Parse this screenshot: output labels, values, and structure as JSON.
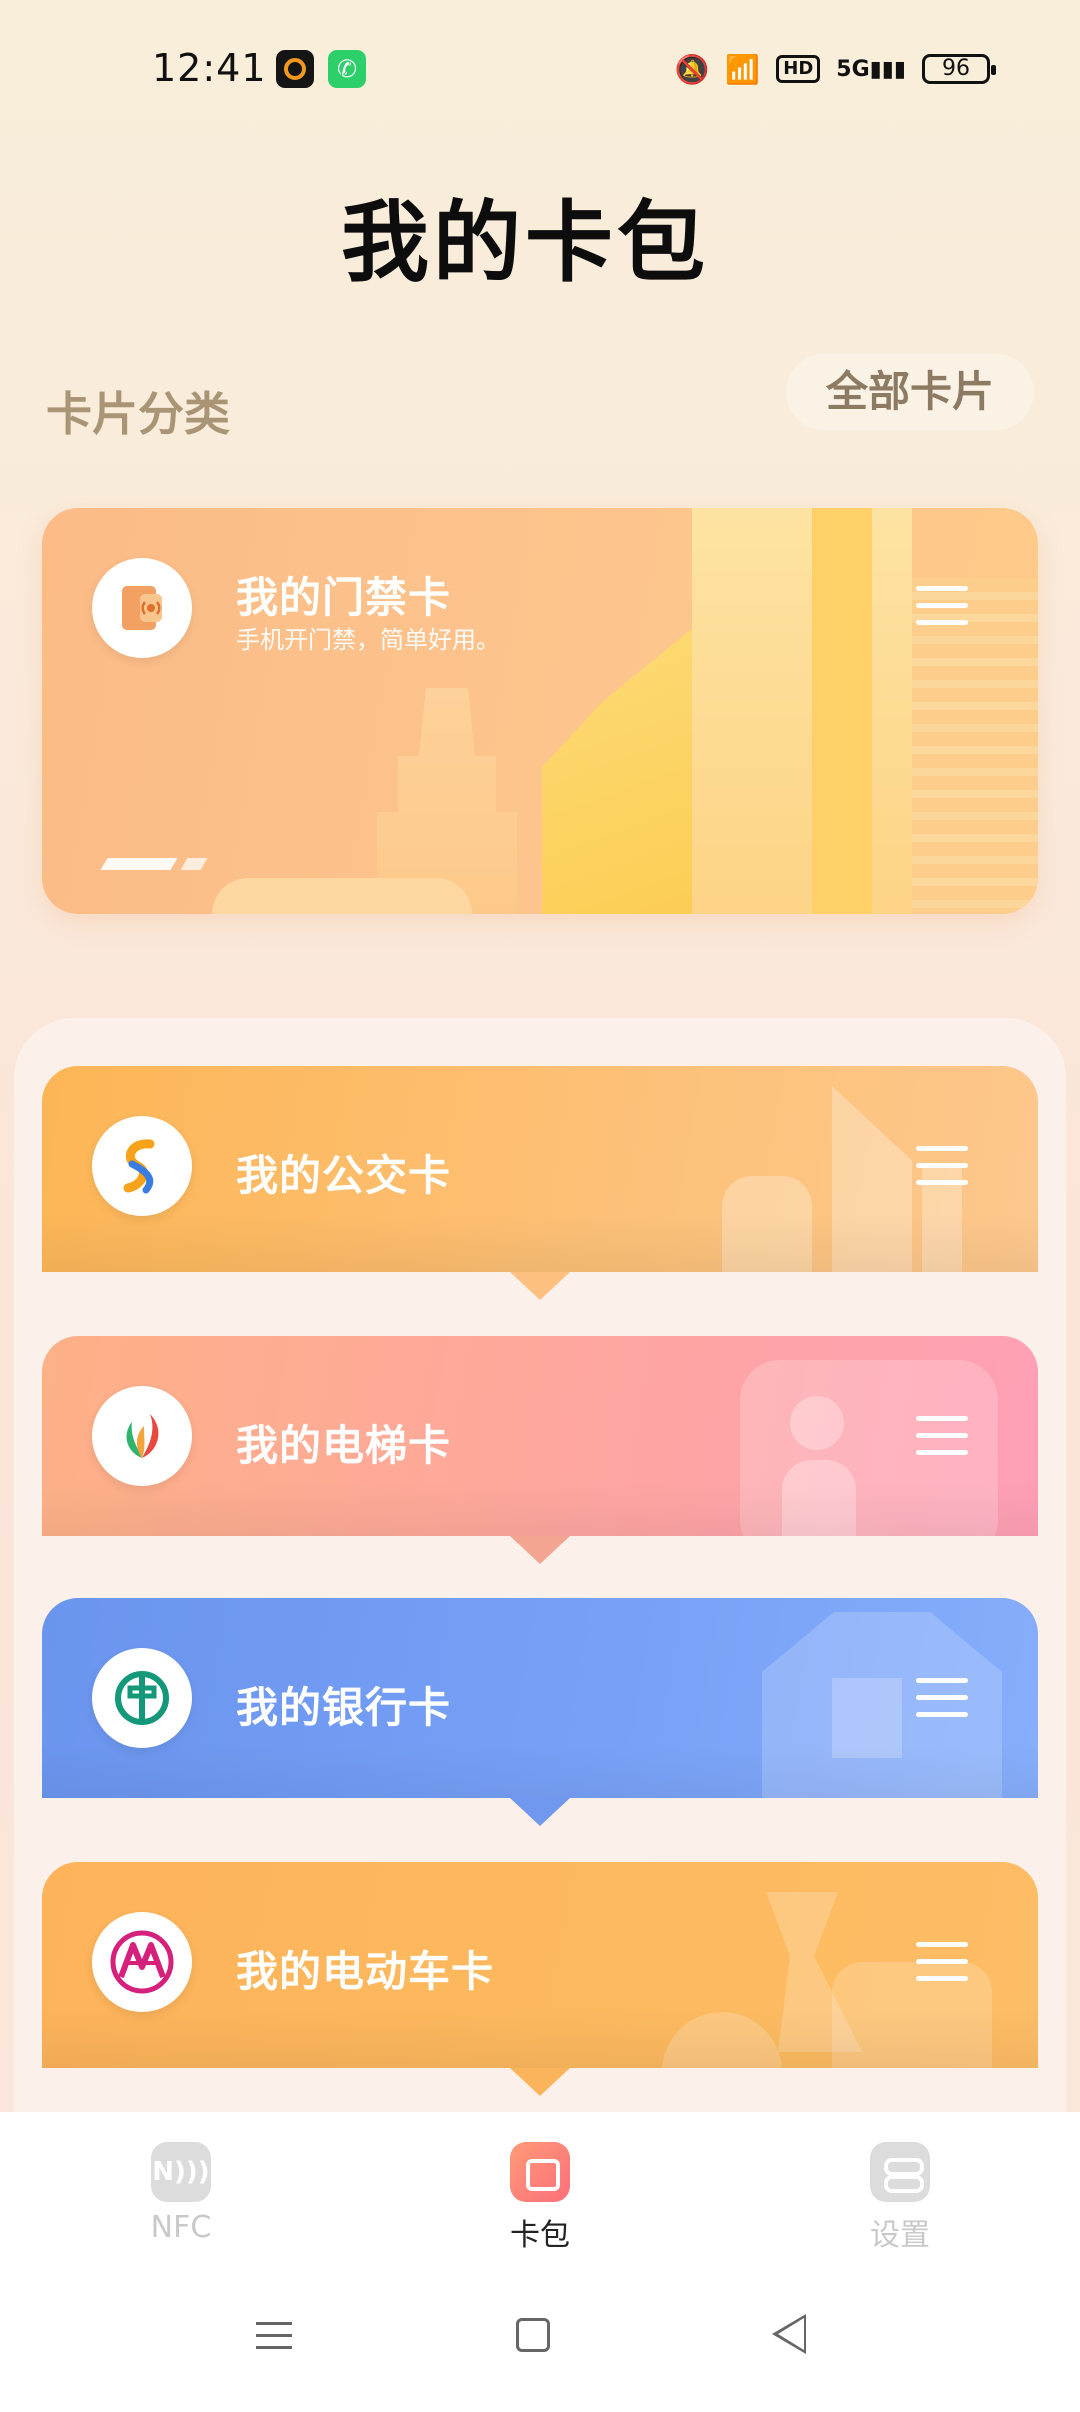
{
  "status_bar": {
    "time": "12:41",
    "battery": "96",
    "hd": "HD",
    "signal": "5G"
  },
  "title": "我的卡包",
  "categories": {
    "label": "卡片分类",
    "all_button": "全部卡片"
  },
  "door_card": {
    "title": "我的门禁卡",
    "subtitle": "手机开门禁，简单好用。"
  },
  "cards": [
    {
      "title": "我的公交卡",
      "icon": "bus-card-logo-icon"
    },
    {
      "title": "我的电梯卡",
      "icon": "elevator-card-logo-icon"
    },
    {
      "title": "我的银行卡",
      "icon": "bank-card-logo-icon"
    },
    {
      "title": "我的电动车卡",
      "icon": "ebike-card-logo-icon"
    }
  ],
  "bottom_nav": {
    "nfc": "NFC",
    "wallet": "卡包",
    "settings": "设置"
  },
  "colors": {
    "accent": "#fb6f7a",
    "bank_blue": "#6a95ee",
    "bus_orange": "#fdb656"
  }
}
